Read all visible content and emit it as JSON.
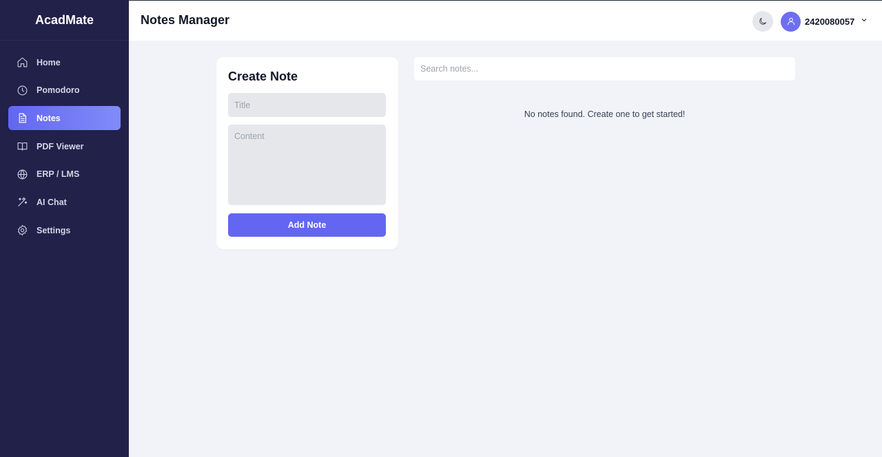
{
  "sidebar": {
    "brand": "AcadMate",
    "items": [
      {
        "label": "Home",
        "icon": "home-icon"
      },
      {
        "label": "Pomodoro",
        "icon": "clock-icon"
      },
      {
        "label": "Notes",
        "icon": "document-icon",
        "active": true
      },
      {
        "label": "PDF Viewer",
        "icon": "book-open-icon"
      },
      {
        "label": "ERP / LMS",
        "icon": "globe-icon"
      },
      {
        "label": "AI Chat",
        "icon": "sparkles-icon"
      },
      {
        "label": "Settings",
        "icon": "gear-icon"
      }
    ]
  },
  "header": {
    "title": "Notes Manager",
    "user_id": "2420080057"
  },
  "create_note": {
    "title": "Create Note",
    "title_placeholder": "Title",
    "content_placeholder": "Content",
    "button_label": "Add Note"
  },
  "search": {
    "placeholder": "Search notes..."
  },
  "notes": {
    "empty_message": "No notes found. Create one to get started!"
  },
  "colors": {
    "sidebar_bg": "#22214a",
    "accent": "#6366f1",
    "page_bg": "#f2f3f8"
  }
}
